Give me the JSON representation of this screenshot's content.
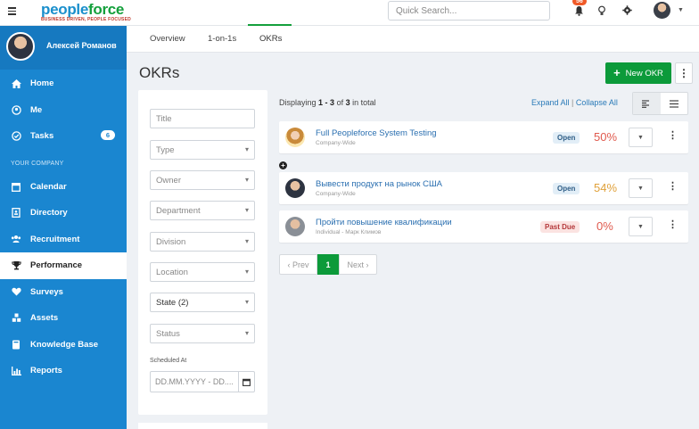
{
  "app": {
    "logo_main": "people",
    "logo_accent": "force",
    "logo_tagline": "BUSINESS DRIVEN, PEOPLE FOCUSED",
    "search_placeholder": "Quick Search...",
    "notification_count": "56"
  },
  "sidebar": {
    "user_name": "Алексей Романов",
    "items": [
      {
        "label": "Home",
        "icon": "home-icon"
      },
      {
        "label": "Me",
        "icon": "user-circle-icon"
      },
      {
        "label": "Tasks",
        "icon": "check-circle-icon",
        "badge": "6"
      }
    ],
    "section_label": "YOUR COMPANY",
    "company_items": [
      {
        "label": "Calendar",
        "icon": "calendar-icon"
      },
      {
        "label": "Directory",
        "icon": "address-book-icon"
      },
      {
        "label": "Recruitment",
        "icon": "users-icon"
      },
      {
        "label": "Performance",
        "icon": "trophy-icon",
        "active": true
      },
      {
        "label": "Surveys",
        "icon": "heart-icon"
      },
      {
        "label": "Assets",
        "icon": "cubes-icon"
      },
      {
        "label": "Knowledge Base",
        "icon": "book-icon"
      },
      {
        "label": "Reports",
        "icon": "bar-chart-icon"
      }
    ]
  },
  "tabs": [
    "Overview",
    "1-on-1s",
    "OKRs"
  ],
  "page": {
    "title": "OKRs",
    "new_button": "New OKR"
  },
  "filters": {
    "title_placeholder": "Title",
    "type": "Type",
    "owner": "Owner",
    "department": "Department",
    "division": "Division",
    "location": "Location",
    "state": "State (2)",
    "status": "Status",
    "scheduled_label": "Scheduled At",
    "date_placeholder": "DD.MM.YYYY - DD...."
  },
  "list": {
    "displaying_prefix": "Displaying",
    "range": "1 - 3",
    "of": "of",
    "total": "3",
    "suffix": "in total",
    "expand_all": "Expand All",
    "separator": "|",
    "collapse_all": "Collapse All"
  },
  "okrs": [
    {
      "title": "Full Peopleforce System Testing",
      "subtitle": "Company-Wide",
      "status": "Open",
      "progress": "50%",
      "progress_color": "#e05a4e"
    },
    {
      "title": "Вывести продукт на рынок США",
      "subtitle": "Company-Wide",
      "status": "Open",
      "progress": "54%",
      "progress_color": "#e0a13a"
    },
    {
      "title": "Пройти повышение квалификации",
      "subtitle": "Individual - Марк Климов",
      "status": "Past Due",
      "progress": "0%",
      "progress_color": "#e05a4e"
    }
  ],
  "pagination": {
    "prev": "‹ Prev",
    "current": "1",
    "next": "Next ›"
  },
  "colors": {
    "brand_blue": "#1a86d0",
    "brand_green": "#0c9a3a"
  }
}
